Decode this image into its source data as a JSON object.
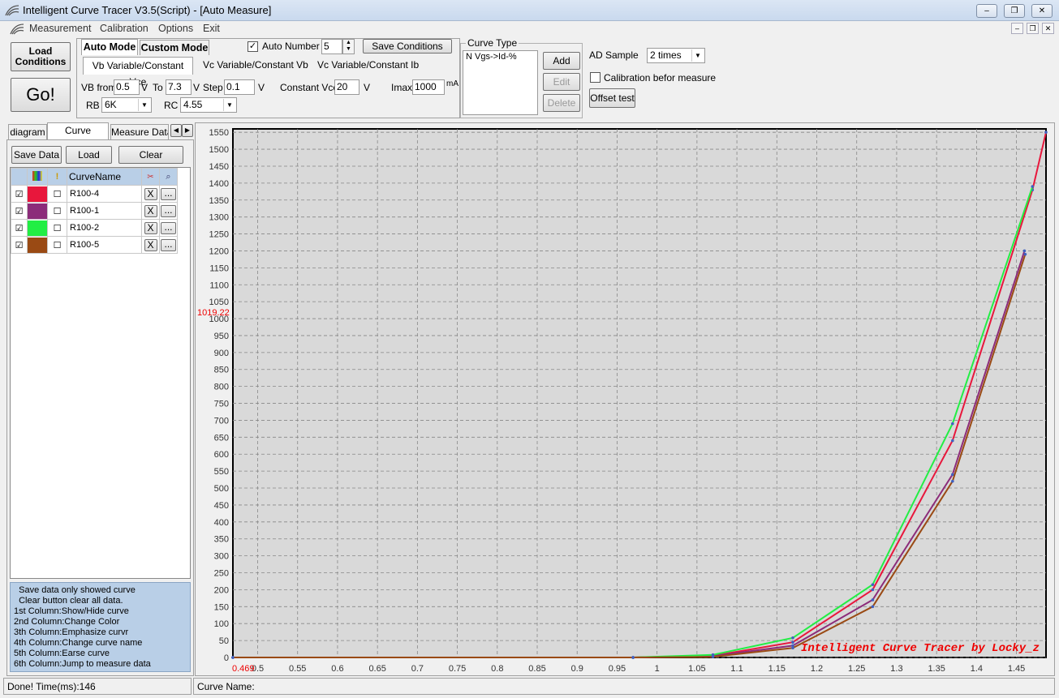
{
  "window": {
    "title": "Intelligent Curve Tracer V3.5(Script) - [Auto Measure]",
    "controls": [
      "‒",
      "❐",
      "✕"
    ],
    "mdi_controls": [
      "‒",
      "❐",
      "✕"
    ]
  },
  "menu": [
    "Measurement",
    "Calibration",
    "Options",
    "Exit"
  ],
  "toolbar": {
    "load_label": "Load\nConditions",
    "go_label": "Go!",
    "tabs": [
      "Auto Mode",
      "Custom Mode"
    ],
    "auto_number_label": "Auto Number",
    "auto_number_value": "5",
    "save_conditions": "Save Conditions",
    "subtabs": [
      "Vb Variable/Constant Vce",
      "Vc Variable/Constant Vb",
      "Vc Variable/Constant Ib"
    ],
    "vb_from_label": "VB from",
    "vb_from": "0.5",
    "unit_v": "V",
    "to_label": "To",
    "vb_to": "7.3",
    "step_label": "Step",
    "step": "0.1",
    "vce_label": "Constant Vce",
    "vce": "20",
    "imax_label": "Imax",
    "imax": "1000",
    "imax_unit": "mA",
    "rb_label": "RB",
    "rb": "6K",
    "rc_label": "RC",
    "rc": "4.55"
  },
  "curve_type": {
    "legend": "Curve Type",
    "item": "N Vgs->Id-%",
    "add": "Add",
    "edit": "Edit",
    "delete": "Delete"
  },
  "ad": {
    "label": "AD Sample",
    "value": "2 times",
    "calib_label": "Calibration befor measure",
    "offset": "Offset test"
  },
  "left_tabs": [
    "diagram",
    "Curve Control",
    "Measure Data"
  ],
  "left_buttons": [
    "Save Data",
    "Load Data",
    "Clear"
  ],
  "curve_table": {
    "header": "CurveName",
    "rows": [
      {
        "name": "R100-4",
        "color": "#e8173c"
      },
      {
        "name": "R100-1",
        "color": "#8c2c7a"
      },
      {
        "name": "R100-2",
        "color": "#22ee44"
      },
      {
        "name": "R100-5",
        "color": "#9a4a14"
      }
    ],
    "x_btn": "X",
    "more_btn": "..."
  },
  "help_lines": [
    "  Save data only showed curve",
    "  Clear button clear all data.",
    "1st Column:Show/Hide curve",
    "2nd Column:Change Color",
    "3th Column:Emphasize curvr",
    "4th Column:Change curve name",
    "5th Column:Earse curve",
    "6th Column:Jump to measure data"
  ],
  "status": {
    "left": "Done!  Time(ms):146",
    "right": "Curve Name:"
  },
  "chart_data": {
    "type": "line",
    "watermark": "Intelligent Curve Tracer by Locky_z",
    "red_marker_y": "1019.22",
    "red_marker_x": "0.469",
    "x_ticks": [
      "0.5",
      "0.55",
      "0.6",
      "0.65",
      "0.7",
      "0.75",
      "0.8",
      "0.85",
      "0.9",
      "0.95",
      "1",
      "1.05",
      "1.1",
      "1.15",
      "1.2",
      "1.25",
      "1.3",
      "1.35",
      "1.4",
      "1.45"
    ],
    "y_ticks": [
      "0",
      "50",
      "100",
      "150",
      "200",
      "250",
      "300",
      "350",
      "400",
      "450",
      "500",
      "550",
      "600",
      "650",
      "700",
      "750",
      "800",
      "850",
      "900",
      "950",
      "1000",
      "1050",
      "1100",
      "1150",
      "1200",
      "1250",
      "1300",
      "1350",
      "1400",
      "1450",
      "1500",
      "1550"
    ],
    "xlim": [
      0.469,
      1.487
    ],
    "ylim": [
      0,
      1560
    ],
    "series": [
      {
        "name": "R100-4",
        "color": "#e8173c",
        "x": [
          0.469,
          0.97,
          1.07,
          1.17,
          1.27,
          1.37,
          1.47,
          1.487
        ],
        "y": [
          0,
          0,
          5,
          45,
          200,
          640,
          1380,
          1550
        ]
      },
      {
        "name": "R100-1",
        "color": "#8c2c7a",
        "x": [
          0.469,
          0.97,
          1.07,
          1.17,
          1.27,
          1.37,
          1.46
        ],
        "y": [
          0,
          0,
          4,
          35,
          170,
          540,
          1200
        ]
      },
      {
        "name": "R100-2",
        "color": "#22ee44",
        "x": [
          0.469,
          0.97,
          1.07,
          1.17,
          1.27,
          1.37,
          1.47
        ],
        "y": [
          0,
          0,
          8,
          58,
          215,
          690,
          1390
        ]
      },
      {
        "name": "R100-5",
        "color": "#9a4a14",
        "x": [
          0.469,
          0.97,
          1.07,
          1.17,
          1.27,
          1.37,
          1.461
        ],
        "y": [
          0,
          0,
          2,
          28,
          150,
          520,
          1190
        ]
      }
    ]
  }
}
